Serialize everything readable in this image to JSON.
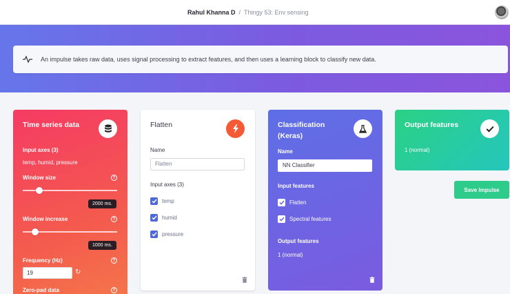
{
  "breadcrumb": {
    "user": "Rahul Khanna D",
    "separator": "/",
    "project": "Thingy 53: Env sensing"
  },
  "info": {
    "message": "An impulse takes raw data, uses signal processing to extract features, and then uses a learning block to classify new data."
  },
  "time_series": {
    "title": "Time series data",
    "icon": "database-icon",
    "input_axes_label": "Input axes (3)",
    "input_axes_value": "temp, humid, pressure",
    "window_size_label": "Window size",
    "window_size_value": "2000 ms.",
    "window_size_level": 0.15,
    "window_increase_label": "Window increase",
    "window_increase_value": "1000 ms.",
    "window_increase_level": 0.1,
    "frequency_label": "Frequency (Hz)",
    "frequency_value": "19",
    "zero_pad_label": "Zero-pad data"
  },
  "flatten": {
    "title": "Flatten",
    "icon": "lightning-icon",
    "name_label": "Name",
    "name_value": "Flatten",
    "input_axes_label": "Input axes (3)",
    "axes": [
      "temp",
      "humid",
      "pressure"
    ]
  },
  "classification": {
    "title_line1": "Classification",
    "title_line2": "(Keras)",
    "icon": "flask-icon",
    "name_label": "Name",
    "name_value": "NN Classifier",
    "input_features_label": "Input features",
    "features": [
      "Flatten",
      "Spectral features"
    ],
    "output_features_label": "Output features",
    "output_features_value": "1 (normal)"
  },
  "output": {
    "title": "Output features",
    "icon": "check-icon",
    "value": "1 (normal)"
  },
  "save_button": "Save Impulse",
  "colors": {
    "accent_red": "#f53b63",
    "accent_purple": "#7b5be0",
    "accent_green": "#2ecc8a",
    "checkbox_blue": "#4f6ad8"
  }
}
